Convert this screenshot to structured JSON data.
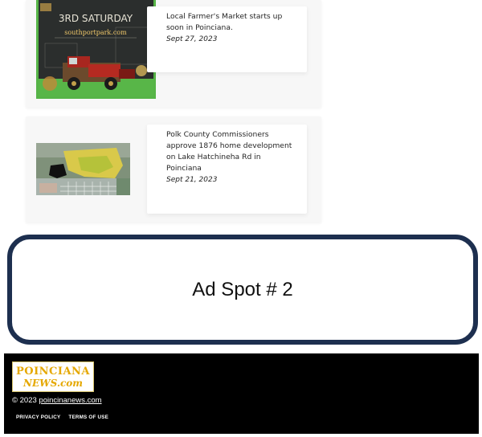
{
  "articles": [
    {
      "title": "Local Farmer's Market starts up soon in Poinciana.",
      "date": "Sept 27, 2023",
      "poster": {
        "headline": "3RD SATURDAY",
        "site": "southportpark.com"
      }
    },
    {
      "title": "Polk County Commissioners approve 1876 home development on Lake Hatchineha Rd in Poinciana",
      "date": "Sept 21, 2023"
    }
  ],
  "ad": {
    "label": "Ad Spot # 2"
  },
  "footer": {
    "logo_top": "POINCIANA",
    "logo_bottom": "NEWS.com",
    "copyright_prefix": "© 2023 ",
    "copyright_link": "poincinanews.com",
    "links": [
      "PRIVACY POLICY",
      "TERMS OF USE"
    ]
  },
  "colors": {
    "ad_border": "#1d2f4f",
    "logo_gold": "#e5a800",
    "footer_bg": "#000000",
    "poster_green": "#56b447"
  }
}
